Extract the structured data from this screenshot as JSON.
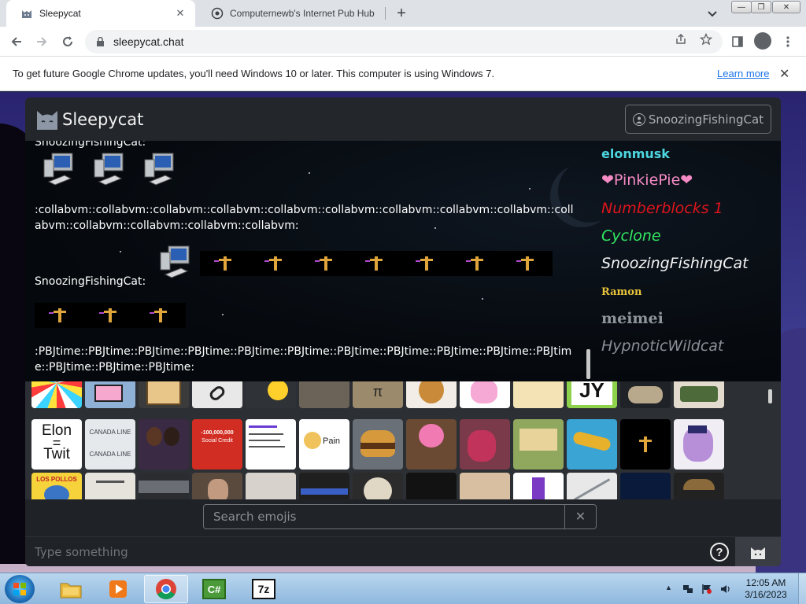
{
  "browser": {
    "tabs": [
      {
        "title": "Sleepycat",
        "close": "✕"
      },
      {
        "title": "Computernewb's Internet Pub Hub"
      }
    ],
    "new_tab": "+",
    "address": "sleepycat.chat",
    "window_controls": [
      "—",
      "❐",
      "✕"
    ]
  },
  "infobar": {
    "message": "To get future Google Chrome updates, you'll need Windows 10 or later. This computer is using Windows 7.",
    "learn_more": "Learn more",
    "close": "✕"
  },
  "app": {
    "title": "Sleepycat",
    "user_button": "SnoozingFishingCat",
    "messages": {
      "top_partial_name": "SnoozingFishingCat:",
      "collab_text": ":collabvm::collabvm::collabvm::collabvm::collabvm::collabvm::collabvm::collabvm::collabvm::collabvm::collabvm::collabvm::collabvm::collabvm:",
      "second_name": "SnoozingFishingCat:",
      "pbj_text": ":PBJtime::PBJtime::PBJtime::PBJtime::PBJtime::PBJtime::PBJtime::PBJtime::PBJtime::PBJtime::PBJtime::PBJtime::PBJtime::PBJtime:"
    },
    "users": [
      "elonmusk",
      "❤PinkiePie❤",
      "Numberblocks 1",
      "Cyclone",
      "SnoozingFishingCat",
      "Ramon",
      "meimei",
      "HypnoticWildcat"
    ],
    "emoji_captions": {
      "elon_top": "Elon",
      "elon_eq": "=",
      "elon_bottom": "Twit",
      "canada_1": "CANADA LINE",
      "canada_2": "CANADA LINE",
      "social_credit_value": "-100,000,000",
      "social_credit_label": "Social Credit",
      "pain": "Pain",
      "pi": "π",
      "jy": "JY",
      "los_pollos": "LOS POLLOS"
    },
    "emoji_search": {
      "placeholder": "Search emojis",
      "clear": "✕"
    },
    "chat_input": {
      "placeholder": "Type something"
    },
    "help": "?"
  },
  "taskbar": {
    "time": "12:05 AM",
    "date": "3/16/2023",
    "apps": [
      "file-explorer",
      "media-player",
      "chrome",
      "csharp",
      "7zip"
    ],
    "csharp_label": "C#",
    "sevenzip_label": "7z"
  }
}
